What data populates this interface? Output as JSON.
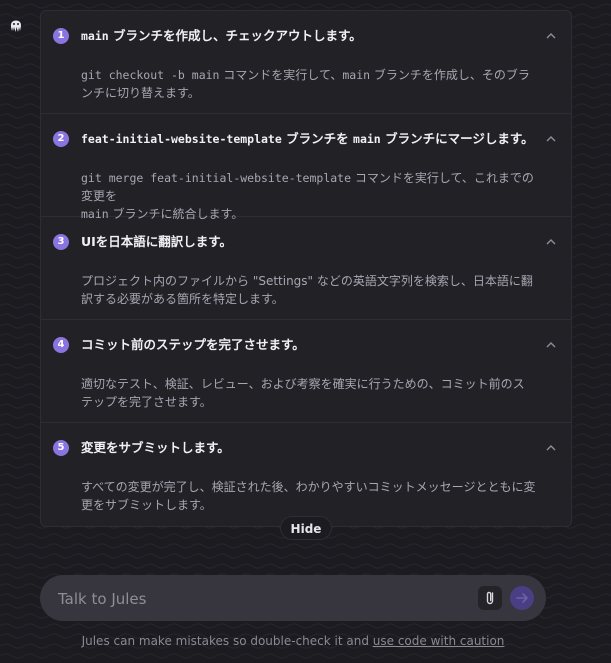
{
  "assistant": {
    "avatar_icon": "octopus-icon"
  },
  "plan": {
    "steps": [
      {
        "number": "1",
        "title_code": "main",
        "title": " ブランチを作成し、チェックアウトします。",
        "desc_code": "git checkout -b main",
        "desc_code2": "main",
        "desc_line1_rest": " コマンドを実行して、",
        "desc_line1_end": " ブランチを作成し、そのブランチに切り",
        "desc_line2": "替えます。"
      },
      {
        "number": "2",
        "title_code": "feat-initial-website-template",
        "title_mid": " ブランチを ",
        "title_code2": "main",
        "title_end": " ブランチにマージします。",
        "desc_code": "git merge feat-initial-website-template",
        "desc_line1_rest": " コマンドを実行して、これまでの変更を",
        "desc_code2": "main",
        "desc_line2_rest": " ブランチに統合します。"
      },
      {
        "number": "3",
        "title": "UIを日本語に翻訳します。",
        "desc": "プロジェクト内のファイルから \"Settings\" などの英語文字列を検索し、日本語に翻訳する必要がある箇所を特定します。"
      },
      {
        "number": "4",
        "title": "コミット前のステップを完了させます。",
        "desc": "適切なテスト、検証、レビュー、および考察を確実に行うための、コミット前のステップを完了させます。"
      },
      {
        "number": "5",
        "title": "変更をサブミットします。",
        "desc": "すべての変更が完了し、検証された後、わかりやすいコミットメッセージとともに変更をサブミットします。"
      }
    ],
    "hide_label": "Hide"
  },
  "input": {
    "placeholder": "Talk to Jules",
    "attach_icon": "paperclip-icon",
    "send_icon": "send-arrow-icon"
  },
  "footer": {
    "text": "Jules can make mistakes so double-check it and ",
    "link": "use code with caution"
  },
  "colors": {
    "accent": "#8a75e0",
    "background": "#1c1b20",
    "panel": "#222126"
  }
}
